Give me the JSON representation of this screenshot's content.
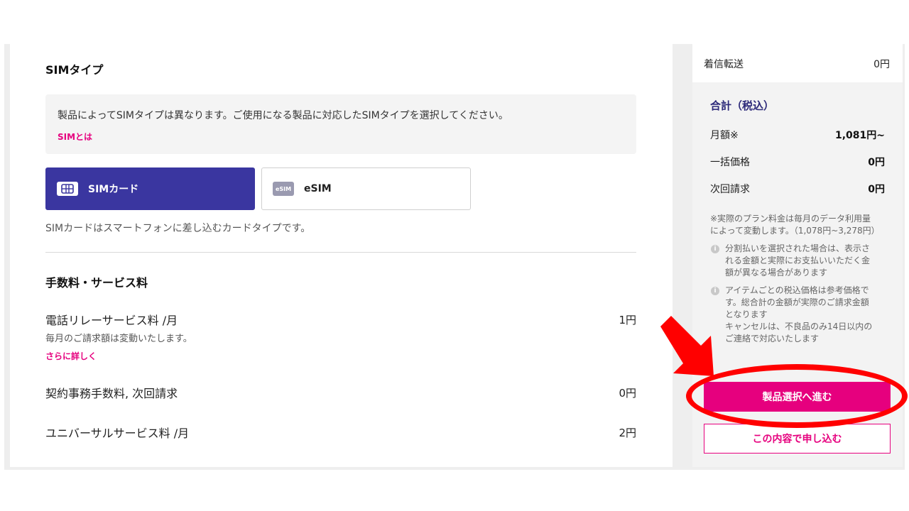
{
  "sim_section": {
    "title": "SIMタイプ",
    "info_text": "製品によってSIMタイプは異なります。ご使用になる製品に対応したSIMタイプを選択してください。",
    "info_link": "SIMとは",
    "options": [
      {
        "label": "SIMカード",
        "icon": "sim-card-icon",
        "selected": true
      },
      {
        "label": "eSIM",
        "icon_text": "eSIM",
        "selected": false
      }
    ],
    "description": "SIMカードはスマートフォンに差し込むカードタイプです。"
  },
  "fees_section": {
    "title": "手数料・サービス料",
    "items": [
      {
        "name": "電話リレーサービス料 /月",
        "price": "1円",
        "sub": "毎月のご請求額は変動いたします。",
        "link": "さらに詳しく"
      },
      {
        "name": "契約事務手数料, 次回請求",
        "price": "0円"
      },
      {
        "name": "ユニバーサルサービス料 /月",
        "price": "2円"
      }
    ]
  },
  "sidebar": {
    "call_forward_label": "着信転送",
    "call_forward_value": "0円",
    "total_title": "合計（税込）",
    "rows": [
      {
        "label": "月額※",
        "value": "1,081円~"
      },
      {
        "label": "一括価格",
        "value": "0円"
      },
      {
        "label": "次回請求",
        "value": "0円"
      }
    ],
    "note_main": [
      "※実際のプラン料金は毎月のデータ利用量",
      "によって変動します。（1,078円~3,278円）"
    ],
    "note_1": [
      "分割払いを選択された場合は、表示さ",
      "れる金額と実際にお支払いいただく金",
      "額が異なる場合があります"
    ],
    "note_2": [
      "アイテムごとの税込価格は参考価格で",
      "す。総合計の金額が実際のご請求金額",
      "となります",
      "キャンセルは、不良品のみ14日以内の",
      "ご連絡で対応いたします"
    ],
    "primary_button": "製品選択へ進む",
    "secondary_button": "この内容で申し込む"
  },
  "colors": {
    "accent": "#e6007e",
    "selected": "#3a36a0",
    "annotation": "#ff0000"
  }
}
